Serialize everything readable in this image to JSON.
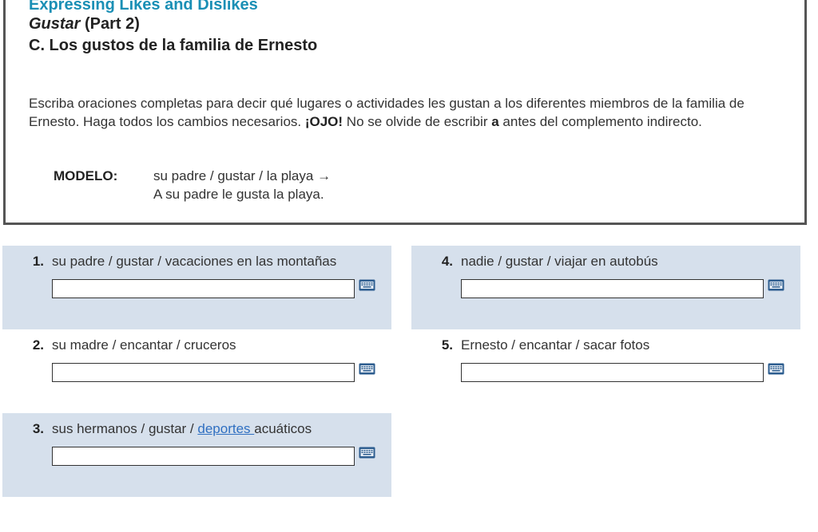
{
  "header": {
    "section_heading": "Expressing Likes and Dislikes",
    "lesson_title_italic": "Gustar",
    "lesson_title_rest": " (Part 2)",
    "activity_title": "C. Los gustos de la familia de Ernesto"
  },
  "directions": {
    "text_1": "Escriba oraciones completas para decir qué lugares o actividades les gustan a los diferentes miembros de la familia de Ernesto. Haga todos los cambios necesarios. ",
    "ojo": "¡OJO!",
    "text_2": " No se olvide de escribir ",
    "a_bold": "a",
    "text_3": " antes del complemento indirecto."
  },
  "modelo": {
    "label": "MODELO:",
    "prompt": "su padre / gustar / la playa →",
    "answer": "A su padre le gusta la playa."
  },
  "questions": [
    {
      "num": "1.",
      "prompt": "su padre / gustar / vacaciones en las montañas",
      "value": "",
      "shaded": true
    },
    {
      "num": "2.",
      "prompt": "su madre / encantar / cruceros",
      "value": "",
      "shaded": false
    },
    {
      "num": "3.",
      "prompt_before": "sus hermanos / gustar / ",
      "prompt_link": "deportes ",
      "prompt_after": " acuáticos",
      "value": "",
      "shaded": true
    },
    {
      "num": "4.",
      "prompt": "nadie / gustar / viajar en autobús",
      "value": "",
      "shaded": true
    },
    {
      "num": "5.",
      "prompt": "Ernesto / encantar / sacar fotos",
      "value": "",
      "shaded": false
    }
  ],
  "colors": {
    "section_heading": "#1a8fb5",
    "card_shade": "#d6e0ec",
    "link": "#2f6fc1",
    "keyboard_icon": "#2d5d8f"
  },
  "icons": {
    "keyboard": "keyboard-icon"
  }
}
